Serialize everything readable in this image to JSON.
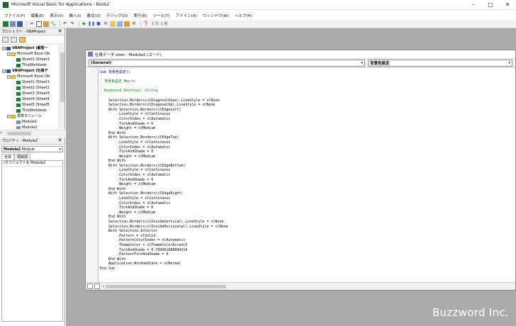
{
  "window": {
    "title": "Microsoft Visual Basic for Applications - Book2",
    "minimize_icon": "minimize-icon",
    "maximize_icon": "maximize-icon",
    "close_icon": "close-icon"
  },
  "menu": [
    "ファイル(F)",
    "編集(E)",
    "表示(V)",
    "挿入(I)",
    "書式(O)",
    "デバッグ(D)",
    "実行(R)",
    "ツール(T)",
    "アドイン(A)",
    "ウィンドウ(W)",
    "ヘルプ(H)"
  ],
  "toolbar": {
    "position_text": "1 行, 1 桁"
  },
  "project_panel": {
    "title": "プロジェクト - VBAProject",
    "tree": [
      {
        "label": "VBAProject (顧客ー",
        "level": 0,
        "bold": true,
        "expander": "−",
        "icon": "project-icon"
      },
      {
        "label": "Microsoft Excel Ob",
        "level": 1,
        "bold": false,
        "expander": "−",
        "icon": "folder-icon"
      },
      {
        "label": "Sheet1 (Sheet1",
        "level": 2,
        "bold": false,
        "expander": "",
        "icon": "sheet-icon"
      },
      {
        "label": "ThisWorkbook",
        "level": 2,
        "bold": false,
        "expander": "",
        "icon": "sheet-icon"
      },
      {
        "label": "VBAProject (社員デ",
        "level": 0,
        "bold": true,
        "expander": "−",
        "icon": "project-icon"
      },
      {
        "label": "Microsoft Excel Ob",
        "level": 1,
        "bold": false,
        "expander": "−",
        "icon": "folder-icon"
      },
      {
        "label": "Sheet1 (Sheet1",
        "level": 2,
        "bold": false,
        "expander": "",
        "icon": "sheet-icon"
      },
      {
        "label": "Sheet2 (Sheet2",
        "level": 2,
        "bold": false,
        "expander": "",
        "icon": "sheet-icon"
      },
      {
        "label": "Sheet3 (Sheet3",
        "level": 2,
        "bold": false,
        "expander": "",
        "icon": "sheet-icon"
      },
      {
        "label": "Sheet4 (Sheet4",
        "level": 2,
        "bold": false,
        "expander": "",
        "icon": "sheet-icon"
      },
      {
        "label": "Sheet5 (Sheet5",
        "level": 2,
        "bold": false,
        "expander": "",
        "icon": "sheet-icon"
      },
      {
        "label": "ThisWorkbook",
        "level": 2,
        "bold": false,
        "expander": "",
        "icon": "sheet-icon"
      },
      {
        "label": "標準モジュール",
        "level": 1,
        "bold": false,
        "expander": "−",
        "icon": "folder-icon"
      },
      {
        "label": "Module1",
        "level": 2,
        "bold": false,
        "expander": "",
        "icon": "module-icon"
      },
      {
        "label": "Module2",
        "level": 2,
        "bold": false,
        "expander": "",
        "icon": "module-icon"
      }
    ]
  },
  "props_panel": {
    "title": "プロパティ - Module2",
    "object_name": "Module2",
    "object_type": "Module",
    "tabs": [
      "全体",
      "項目別"
    ],
    "rows": [
      {
        "key": "(オブジェクト名)",
        "value": "Module2"
      }
    ]
  },
  "code_window": {
    "title": "社員データ.xlsm - Module2 (コード)",
    "object_combo": "(General)",
    "proc_combo": "背景色設定",
    "lines": [
      {
        "t": "Sub 背景色設定()",
        "c": "kw"
      },
      {
        "t": "'",
        "c": "cm"
      },
      {
        "t": "' 背景色設定 Macro",
        "c": "cm"
      },
      {
        "t": "'",
        "c": "cm"
      },
      {
        "t": "' Keyboard Shortcut: Ctrl+q",
        "c": "cm"
      },
      {
        "t": "'",
        "c": "cm"
      },
      {
        "t": "    Selection.Borders(xlDiagonalDown).LineStyle = xlNone",
        "c": ""
      },
      {
        "t": "    Selection.Borders(xlDiagonalUp).LineStyle = xlNone",
        "c": ""
      },
      {
        "t": "    With Selection.Borders(xlEdgeLeft)",
        "c": ""
      },
      {
        "t": "        .LineStyle = xlContinuous",
        "c": ""
      },
      {
        "t": "        .ColorIndex = xlAutomatic",
        "c": ""
      },
      {
        "t": "        .TintAndShade = 0",
        "c": ""
      },
      {
        "t": "        .Weight = xlMedium",
        "c": ""
      },
      {
        "t": "    End With",
        "c": ""
      },
      {
        "t": "    With Selection.Borders(xlEdgeTop)",
        "c": ""
      },
      {
        "t": "        .LineStyle = xlContinuous",
        "c": ""
      },
      {
        "t": "        .ColorIndex = xlAutomatic",
        "c": ""
      },
      {
        "t": "        .TintAndShade = 0",
        "c": ""
      },
      {
        "t": "        .Weight = xlMedium",
        "c": ""
      },
      {
        "t": "    End With",
        "c": ""
      },
      {
        "t": "    With Selection.Borders(xlEdgeBottom)",
        "c": ""
      },
      {
        "t": "        .LineStyle = xlContinuous",
        "c": ""
      },
      {
        "t": "        .ColorIndex = xlAutomatic",
        "c": ""
      },
      {
        "t": "        .TintAndShade = 0",
        "c": ""
      },
      {
        "t": "        .Weight = xlMedium",
        "c": ""
      },
      {
        "t": "    End With",
        "c": ""
      },
      {
        "t": "    With Selection.Borders(xlEdgeRight)",
        "c": ""
      },
      {
        "t": "        .LineStyle = xlContinuous",
        "c": ""
      },
      {
        "t": "        .ColorIndex = xlAutomatic",
        "c": ""
      },
      {
        "t": "        .TintAndShade = 0",
        "c": ""
      },
      {
        "t": "        .Weight = xlMedium",
        "c": ""
      },
      {
        "t": "    End With",
        "c": ""
      },
      {
        "t": "    Selection.Borders(xlInsideVertical).LineStyle = xlNone",
        "c": ""
      },
      {
        "t": "    Selection.Borders(xlInsideHorizontal).LineStyle = xlNone",
        "c": ""
      },
      {
        "t": "    With Selection.Interior",
        "c": ""
      },
      {
        "t": "        .Pattern = xlSolid",
        "c": ""
      },
      {
        "t": "        .PatternColorIndex = xlAutomatic",
        "c": ""
      },
      {
        "t": "        .ThemeColor = xlThemeColorAccent5",
        "c": ""
      },
      {
        "t": "        .TintAndShade = 0.799981688894314",
        "c": ""
      },
      {
        "t": "        .PatternTintAndShade = 0",
        "c": ""
      },
      {
        "t": "    End With",
        "c": ""
      },
      {
        "t": "    Application.WindowState = xlNormal",
        "c": ""
      },
      {
        "t": "End Sub",
        "c": "kw"
      }
    ]
  },
  "watermark": "Buzzword Inc.",
  "colors": {
    "mdi_background": "#ababab",
    "comment": "#007a00",
    "keyword": "#00008b"
  }
}
